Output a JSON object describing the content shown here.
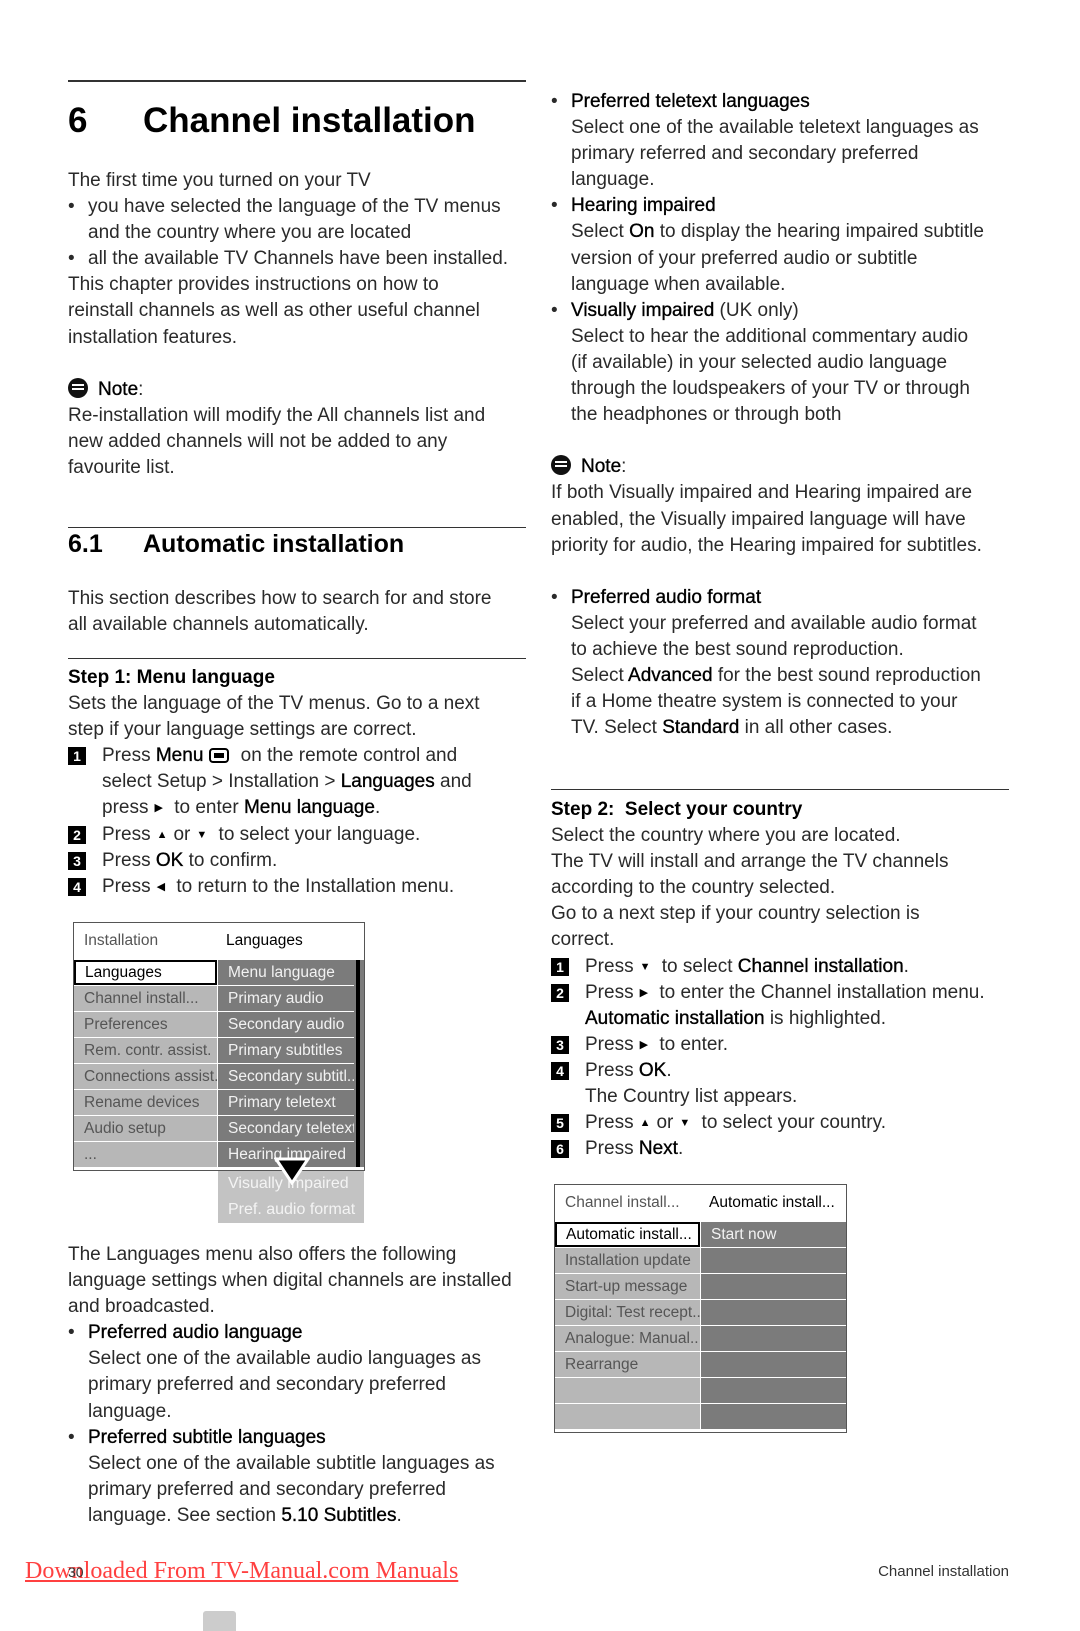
{
  "page": {
    "chapter_number": "6",
    "chapter_title": "Channel installation",
    "section_number": "6.1",
    "section_title": "Automatic installation",
    "page_number": "30",
    "footer_title": "Channel installation",
    "download_link": "Downloaded From TV-Manual.com Manuals",
    "link_color": "#ff4040"
  },
  "left_blocks": [
    {
      "lines": [
        {
          "k": "p",
          "s": [
            {
              "t": "The first time you turned on your TV"
            }
          ]
        },
        {
          "k": "b",
          "s": [
            {
              "t": "you have selected the language of the TV menus"
            }
          ]
        },
        {
          "k": "i",
          "s": [
            {
              "t": "and the country where you are located"
            }
          ]
        },
        {
          "k": "b",
          "s": [
            {
              "t": "all the available TV Channels have been installed."
            }
          ]
        },
        {
          "k": "p",
          "s": [
            {
              "t": "This chapter provides instructions on how to"
            }
          ]
        },
        {
          "k": "p",
          "s": [
            {
              "t": "reinstall channels as well as other useful channel"
            }
          ]
        },
        {
          "k": "p",
          "s": [
            {
              "t": "installation features."
            }
          ]
        },
        {
          "k": "e",
          "s": []
        },
        {
          "k": "n",
          "s": [
            {
              "t": "Note",
              "em": 1
            },
            {
              "t": ":"
            }
          ]
        },
        {
          "k": "p",
          "s": [
            {
              "t": "Re-installation will modify the All channels list and"
            }
          ]
        },
        {
          "k": "p",
          "s": [
            {
              "t": "new added channels will not be added to any"
            }
          ]
        },
        {
          "k": "p",
          "s": [
            {
              "t": "favourite list."
            }
          ]
        }
      ]
    },
    {
      "lines": [
        {
          "k": "p",
          "s": [
            {
              "t": "This section describes how to search for and store"
            }
          ]
        },
        {
          "k": "p",
          "s": [
            {
              "t": "all available channels automatically."
            }
          ]
        }
      ]
    },
    {
      "lines": [
        {
          "k": "h",
          "s": [
            {
              "t": "Step 1: Menu language"
            }
          ]
        },
        {
          "k": "p",
          "s": [
            {
              "t": "Sets the language of the TV menus. Go to a next"
            }
          ]
        },
        {
          "k": "p",
          "s": [
            {
              "t": "step if your language settings are correct."
            }
          ]
        },
        {
          "k": "s",
          "n": "1",
          "s": [
            {
              "t": "Press "
            },
            {
              "t": "Menu",
              "em": 1
            },
            {
              "icon": "menu-button-icon"
            },
            {
              "t": " on the remote control and"
            }
          ]
        },
        {
          "k": "c",
          "s": [
            {
              "t": "select Setup > Installation > "
            },
            {
              "t": "Languages",
              "em": 1
            },
            {
              "t": " and"
            }
          ]
        },
        {
          "k": "c",
          "s": [
            {
              "t": "press"
            },
            {
              "icon": "right-arrow-icon"
            },
            {
              "t": " to enter "
            },
            {
              "t": "Menu language",
              "em": 1
            },
            {
              "t": "."
            }
          ]
        },
        {
          "k": "s",
          "n": "2",
          "s": [
            {
              "t": "Press"
            },
            {
              "icon": "up-arrow-icon"
            },
            {
              "t": "or"
            },
            {
              "icon": "down-arrow-icon"
            },
            {
              "t": " to select your language."
            }
          ]
        },
        {
          "k": "s",
          "n": "3",
          "s": [
            {
              "t": "Press "
            },
            {
              "t": "OK",
              "em": 1
            },
            {
              "t": " to confirm."
            }
          ]
        },
        {
          "k": "s",
          "n": "4",
          "s": [
            {
              "t": "Press"
            },
            {
              "icon": "left-arrow-icon"
            },
            {
              "t": " to return to the Installation menu."
            }
          ]
        }
      ]
    },
    {
      "lines": [
        {
          "k": "p",
          "s": [
            {
              "t": "The Languages menu also offers the following"
            }
          ]
        },
        {
          "k": "p",
          "s": [
            {
              "t": "language settings when digital channels are installed"
            }
          ]
        },
        {
          "k": "p",
          "s": [
            {
              "t": "and broadcasted."
            }
          ]
        },
        {
          "k": "b",
          "s": [
            {
              "t": "Preferred audio language",
              "em": 1
            }
          ]
        },
        {
          "k": "i",
          "s": [
            {
              "t": "Select one of the available audio languages as"
            }
          ]
        },
        {
          "k": "i",
          "s": [
            {
              "t": "primary preferred and secondary preferred"
            }
          ]
        },
        {
          "k": "i",
          "s": [
            {
              "t": "language."
            }
          ]
        },
        {
          "k": "b",
          "s": [
            {
              "t": "Preferred subtitle languages",
              "em": 1
            }
          ]
        },
        {
          "k": "i",
          "s": [
            {
              "t": "Select one of the available subtitle languages as"
            }
          ]
        },
        {
          "k": "i",
          "s": [
            {
              "t": "primary preferred and secondary preferred"
            }
          ]
        },
        {
          "k": "i",
          "s": [
            {
              "t": "language. See section "
            },
            {
              "t": "5.10 Subtitles",
              "em": 1
            },
            {
              "t": "."
            }
          ]
        }
      ]
    }
  ],
  "right_blocks": [
    {
      "lines": [
        {
          "k": "b",
          "s": [
            {
              "t": "Preferred teletext languages",
              "em": 1
            }
          ]
        },
        {
          "k": "i",
          "s": [
            {
              "t": "Select one of the available teletext languages as"
            }
          ]
        },
        {
          "k": "i",
          "s": [
            {
              "t": "primary referred and secondary preferred"
            }
          ]
        },
        {
          "k": "i",
          "s": [
            {
              "t": "language."
            }
          ]
        },
        {
          "k": "b",
          "s": [
            {
              "t": "Hearing impaired",
              "em": 1
            }
          ]
        },
        {
          "k": "i",
          "s": [
            {
              "t": "Select "
            },
            {
              "t": "On",
              "em": 1
            },
            {
              "t": " to display the hearing impaired subtitle"
            }
          ]
        },
        {
          "k": "i",
          "s": [
            {
              "t": "version of your preferred audio or subtitle"
            }
          ]
        },
        {
          "k": "i",
          "s": [
            {
              "t": "language when available."
            }
          ]
        },
        {
          "k": "b",
          "s": [
            {
              "t": "Visually impaired",
              "em": 1
            },
            {
              "t": " (UK only)"
            }
          ]
        },
        {
          "k": "i",
          "s": [
            {
              "t": "Select to hear the additional commentary audio"
            }
          ]
        },
        {
          "k": "i",
          "s": [
            {
              "t": "(if available) in your selected audio language"
            }
          ]
        },
        {
          "k": "i",
          "s": [
            {
              "t": "through the loudspeakers of your TV or through"
            }
          ]
        },
        {
          "k": "i",
          "s": [
            {
              "t": "the headphones or through both"
            }
          ]
        },
        {
          "k": "e",
          "s": []
        },
        {
          "k": "n",
          "s": [
            {
              "t": "Note",
              "em": 1
            },
            {
              "t": ":"
            }
          ]
        },
        {
          "k": "p",
          "s": [
            {
              "t": "If both Visually impaired and Hearing impaired are"
            }
          ]
        },
        {
          "k": "p",
          "s": [
            {
              "t": "enabled, the Visually impaired language will have"
            }
          ]
        },
        {
          "k": "p",
          "s": [
            {
              "t": "priority for audio, the Hearing impaired for subtitles."
            }
          ]
        },
        {
          "k": "e",
          "s": []
        },
        {
          "k": "b",
          "s": [
            {
              "t": "Preferred audio format",
              "em": 1
            }
          ]
        },
        {
          "k": "i",
          "s": [
            {
              "t": "Select your preferred and available audio format"
            }
          ]
        },
        {
          "k": "i",
          "s": [
            {
              "t": "to achieve the best sound reproduction."
            }
          ]
        },
        {
          "k": "i",
          "s": [
            {
              "t": "Select "
            },
            {
              "t": "Advanced",
              "em": 1
            },
            {
              "t": " for the best sound reproduction"
            }
          ]
        },
        {
          "k": "i",
          "s": [
            {
              "t": "if a Home theatre system is connected to your"
            }
          ]
        },
        {
          "k": "i",
          "s": [
            {
              "t": "TV. Select "
            },
            {
              "t": "Standard",
              "em": 1
            },
            {
              "t": " in all other cases."
            }
          ]
        }
      ]
    },
    {
      "lines": [
        {
          "k": "h",
          "s": [
            {
              "t": "Step 2:  Select your country"
            }
          ]
        },
        {
          "k": "p",
          "s": [
            {
              "t": "Select the country where you are located."
            }
          ]
        },
        {
          "k": "p",
          "s": [
            {
              "t": "The TV will install and arrange the TV channels"
            }
          ]
        },
        {
          "k": "p",
          "s": [
            {
              "t": "according to the country selected."
            }
          ]
        },
        {
          "k": "p",
          "s": [
            {
              "t": "Go to a next step if your country selection is"
            }
          ]
        },
        {
          "k": "p",
          "s": [
            {
              "t": "correct."
            }
          ]
        },
        {
          "k": "s",
          "n": "1",
          "s": [
            {
              "t": "Press"
            },
            {
              "icon": "down-arrow-icon"
            },
            {
              "t": " to select "
            },
            {
              "t": "Channel installation",
              "em": 1
            },
            {
              "t": "."
            }
          ]
        },
        {
          "k": "s",
          "n": "2",
          "s": [
            {
              "t": "Press"
            },
            {
              "icon": "right-arrow-icon"
            },
            {
              "t": " to enter the Channel installation menu."
            }
          ]
        },
        {
          "k": "c",
          "s": [
            {
              "t": "Automatic installation",
              "em": 1
            },
            {
              "t": " is highlighted."
            }
          ]
        },
        {
          "k": "s",
          "n": "3",
          "s": [
            {
              "t": "Press"
            },
            {
              "icon": "right-arrow-icon"
            },
            {
              "t": " to enter."
            }
          ]
        },
        {
          "k": "s",
          "n": "4",
          "s": [
            {
              "t": "Press "
            },
            {
              "t": "OK",
              "em": 1
            },
            {
              "t": "."
            }
          ]
        },
        {
          "k": "c",
          "s": [
            {
              "t": "The Country list appears."
            }
          ]
        },
        {
          "k": "s",
          "n": "5",
          "s": [
            {
              "t": "Press"
            },
            {
              "icon": "up-arrow-icon"
            },
            {
              "t": "or"
            },
            {
              "icon": "down-arrow-icon"
            },
            {
              "t": " to select your country."
            }
          ]
        },
        {
          "k": "s",
          "n": "6",
          "s": [
            {
              "t": "Press "
            },
            {
              "t": "Next",
              "em": 1
            },
            {
              "t": "."
            }
          ]
        }
      ]
    }
  ],
  "menu_languages": {
    "header_left": "Installation",
    "header_right": "Languages",
    "left_items": [
      "Languages",
      "Channel install...",
      "Preferences",
      "Rem. contr. assist.",
      "Connections assist.",
      "Rename devices",
      "Audio setup",
      "..."
    ],
    "selected_left": 0,
    "right_items": [
      "Menu language",
      "Primary audio",
      "Secondary audio",
      "Primary subtitles",
      "Secondary subtitl..",
      "Primary teletext",
      "Secondary teletext",
      "Hearing impaired"
    ],
    "overflow_items": [
      "Visually impaired",
      "Pref. audio format"
    ],
    "scroll_indicator_icon": "down-triangle-icon"
  },
  "menu_channel": {
    "header_left": "Channel install...",
    "header_right": "Automatic install...",
    "left_items": [
      "Automatic install...",
      "Installation update",
      "Start-up message",
      "Digital: Test recept...",
      "Analogue: Manual...",
      "Rearrange",
      "",
      ""
    ],
    "selected_left": 0,
    "right_items": [
      "Start now",
      "",
      "",
      "",
      "",
      "",
      "",
      ""
    ]
  }
}
